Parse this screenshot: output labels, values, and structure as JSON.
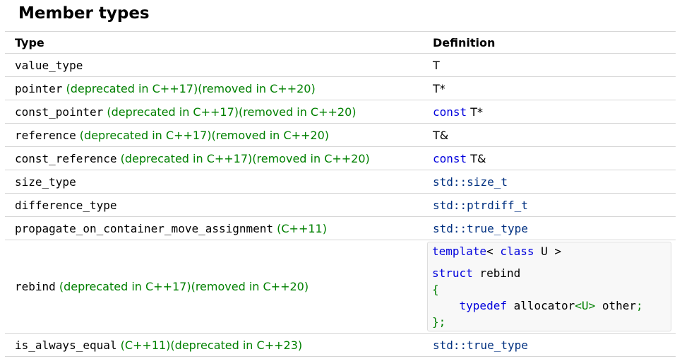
{
  "section": {
    "title": "Member types"
  },
  "table": {
    "headers": [
      "Type",
      "Definition"
    ],
    "rows": [
      {
        "name": "value_type",
        "note": "",
        "definition": "T"
      },
      {
        "name": "pointer",
        "note": "(deprecated in C++17)(removed in C++20)",
        "definition": "T*"
      },
      {
        "name": "const_pointer",
        "note": "(deprecated in C++17)(removed in C++20)",
        "def_kw": "const",
        "definition": "T*"
      },
      {
        "name": "reference",
        "note": "(deprecated in C++17)(removed in C++20)",
        "definition": "T&"
      },
      {
        "name": "const_reference",
        "note": "(deprecated in C++17)(removed in C++20)",
        "def_kw": "const",
        "definition": "T&"
      },
      {
        "name": "size_type",
        "note": "",
        "definition": "std::size_t"
      },
      {
        "name": "difference_type",
        "note": "",
        "definition": "std::ptrdiff_t"
      },
      {
        "name": "propagate_on_container_move_assignment",
        "note": "(C++11)",
        "definition": "std::true_type"
      },
      {
        "name": "rebind",
        "note": "(deprecated in C++17)(removed in C++20)",
        "code": {
          "line1_kw1": "template",
          "line1_mid": "< ",
          "line1_kw2": "class",
          "line1_end": " U >",
          "line2_kw": "struct",
          "line2_name": " rebind",
          "line3_brace": "{",
          "line4_indent": "    ",
          "line4_kw": "typedef",
          "line4_type": " allocator",
          "line4_targ": "<U>",
          "line4_name": " other",
          "line4_semi": ";",
          "line5_close": "};"
        }
      },
      {
        "name": "is_always_equal",
        "note": "(C++11)(deprecated in C++23)",
        "definition": "std::true_type"
      }
    ]
  }
}
